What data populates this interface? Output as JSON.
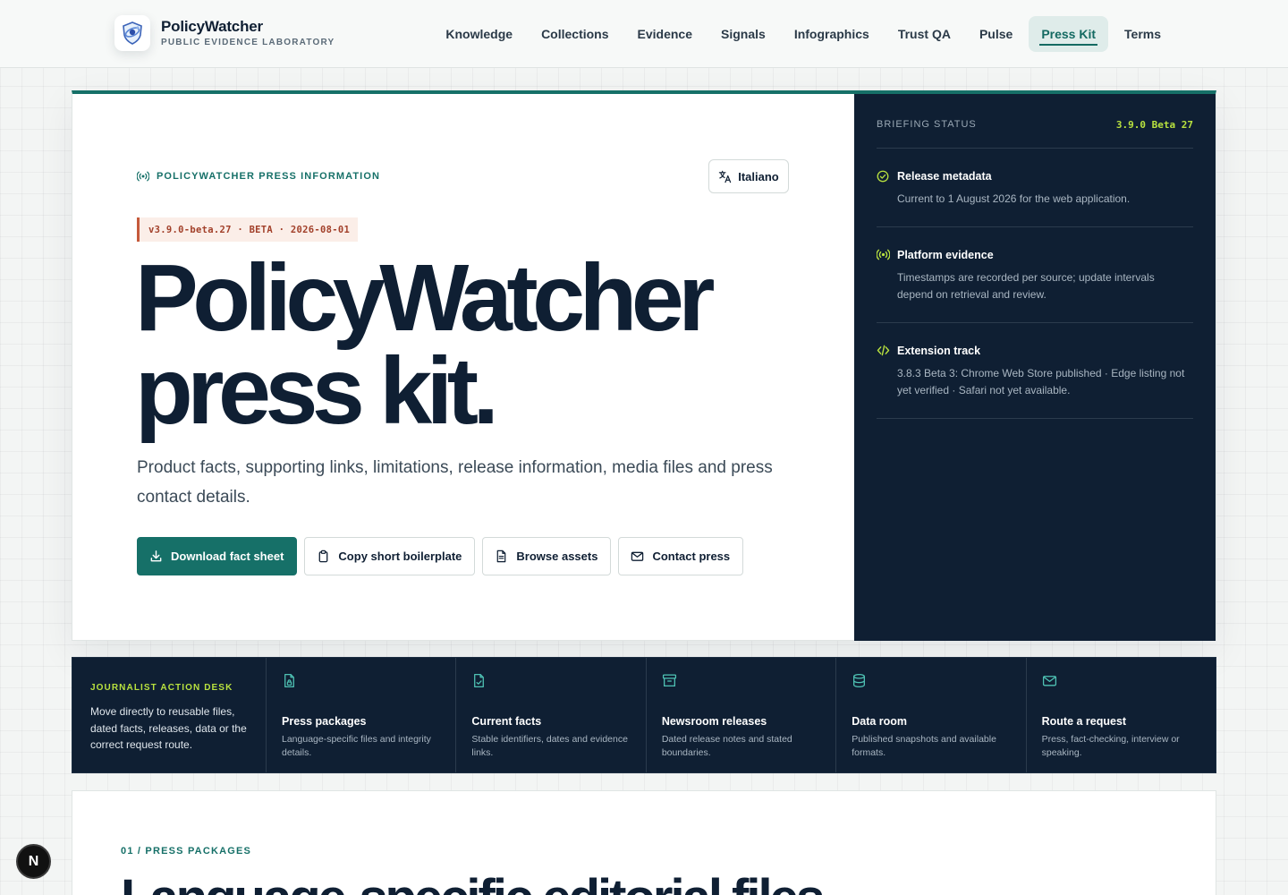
{
  "brand": {
    "name": "PolicyWatcher",
    "subtitle": "PUBLIC EVIDENCE LABORATORY"
  },
  "nav": {
    "items": [
      {
        "label": "Knowledge",
        "active": false
      },
      {
        "label": "Collections",
        "active": false
      },
      {
        "label": "Evidence",
        "active": false
      },
      {
        "label": "Signals",
        "active": false
      },
      {
        "label": "Infographics",
        "active": false
      },
      {
        "label": "Trust QA",
        "active": false
      },
      {
        "label": "Pulse",
        "active": false
      },
      {
        "label": "Press Kit",
        "active": true
      },
      {
        "label": "Terms",
        "active": false
      }
    ]
  },
  "hero": {
    "eyebrow": "POLICYWATCHER PRESS INFORMATION",
    "language_button": "Italiano",
    "version_tag": "v3.9.0-beta.27 · BETA · 2026-08-01",
    "title_line1": "PolicyWatcher",
    "title_line2": "press kit.",
    "description": "Product facts, supporting links, limitations, release information, media files and press contact details.",
    "actions": {
      "download": "Download fact sheet",
      "copy": "Copy short boilerplate",
      "browse": "Browse assets",
      "contact": "Contact press"
    }
  },
  "briefing": {
    "label": "BRIEFING STATUS",
    "version": "3.9.0 Beta 27",
    "items": [
      {
        "icon": "check-circle-icon",
        "title": "Release metadata",
        "text": "Current to 1 August 2026 for the web application."
      },
      {
        "icon": "broadcast-icon",
        "title": "Platform evidence",
        "text": "Timestamps are recorded per source; update intervals depend on retrieval and review."
      },
      {
        "icon": "code-icon",
        "title": "Extension track",
        "text": "3.8.3 Beta 3: Chrome Web Store published · Edge listing not yet verified · Safari not yet available."
      }
    ]
  },
  "desk": {
    "eyebrow": "JOURNALIST ACTION DESK",
    "intro": "Move directly to reusable files, dated facts, releases, data or the correct request route.",
    "cards": [
      {
        "icon": "file-lock-icon",
        "title": "Press packages",
        "text": "Language-specific files and integrity details."
      },
      {
        "icon": "file-check-icon",
        "title": "Current facts",
        "text": "Stable identifiers, dates and evidence links."
      },
      {
        "icon": "archive-icon",
        "title": "Newsroom releases",
        "text": "Dated release notes and stated boundaries."
      },
      {
        "icon": "database-icon",
        "title": "Data room",
        "text": "Published snapshots and available formats."
      },
      {
        "icon": "mail-icon",
        "title": "Route a request",
        "text": "Press, fact-checking, interview or speaking."
      }
    ]
  },
  "packages": {
    "eyebrow": "01 / PRESS PACKAGES",
    "title": "Language-specific editorial files"
  },
  "fab": {
    "label": "N"
  },
  "colors": {
    "accent": "#167068",
    "navy": "#0f1f33",
    "lime": "#b9e23f",
    "version_red": "#a2402a"
  }
}
